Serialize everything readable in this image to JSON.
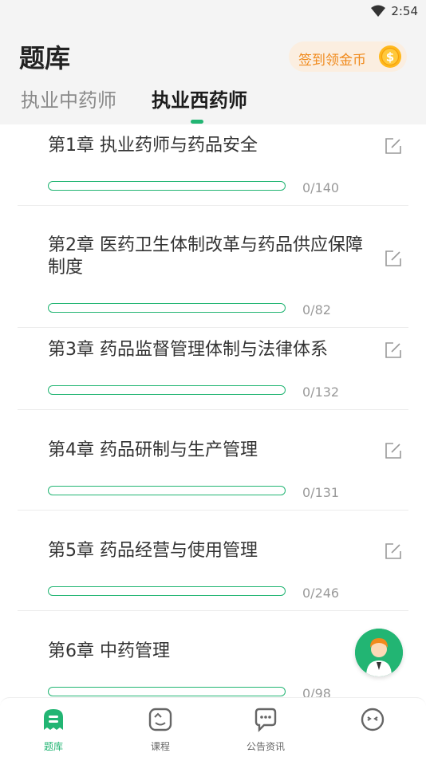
{
  "status_bar": {
    "time": "2:54",
    "icons": [
      "wifi-icon"
    ]
  },
  "header": {
    "title": "题库",
    "checkin_label": "签到领金币",
    "checkin_icon": "coin-icon"
  },
  "tabs": [
    {
      "label": "执业中药师",
      "active": false
    },
    {
      "label": "执业西药师",
      "active": true
    }
  ],
  "chapters": [
    {
      "title": "第1章  执业药师与药品安全",
      "progress": "0/140",
      "done": 0,
      "total": 140
    },
    {
      "title": "第2章  医药卫生体制改革与药品供应保障制度",
      "progress": "0/82",
      "done": 0,
      "total": 82
    },
    {
      "title": "第3章  药品监督管理体制与法律体系",
      "progress": "0/132",
      "done": 0,
      "total": 132
    },
    {
      "title": "第4章  药品研制与生产管理",
      "progress": "0/131",
      "done": 0,
      "total": 131
    },
    {
      "title": "第5章  药品经营与使用管理",
      "progress": "0/246",
      "done": 0,
      "total": 246
    },
    {
      "title": "第6章  中药管理",
      "progress": "0/98",
      "done": 0,
      "total": 98
    }
  ],
  "bottom_nav": [
    {
      "label": "题库",
      "icon": "question-bank-icon",
      "active": true
    },
    {
      "label": "课程",
      "icon": "course-icon",
      "active": false
    },
    {
      "label": "公告资讯",
      "icon": "news-icon",
      "active": false
    },
    {
      "label": "",
      "icon": "profile-icon",
      "active": false
    }
  ],
  "colors": {
    "accent": "#22b573",
    "checkin_text": "#f08a1c",
    "checkin_bg": "#fbeee0"
  }
}
